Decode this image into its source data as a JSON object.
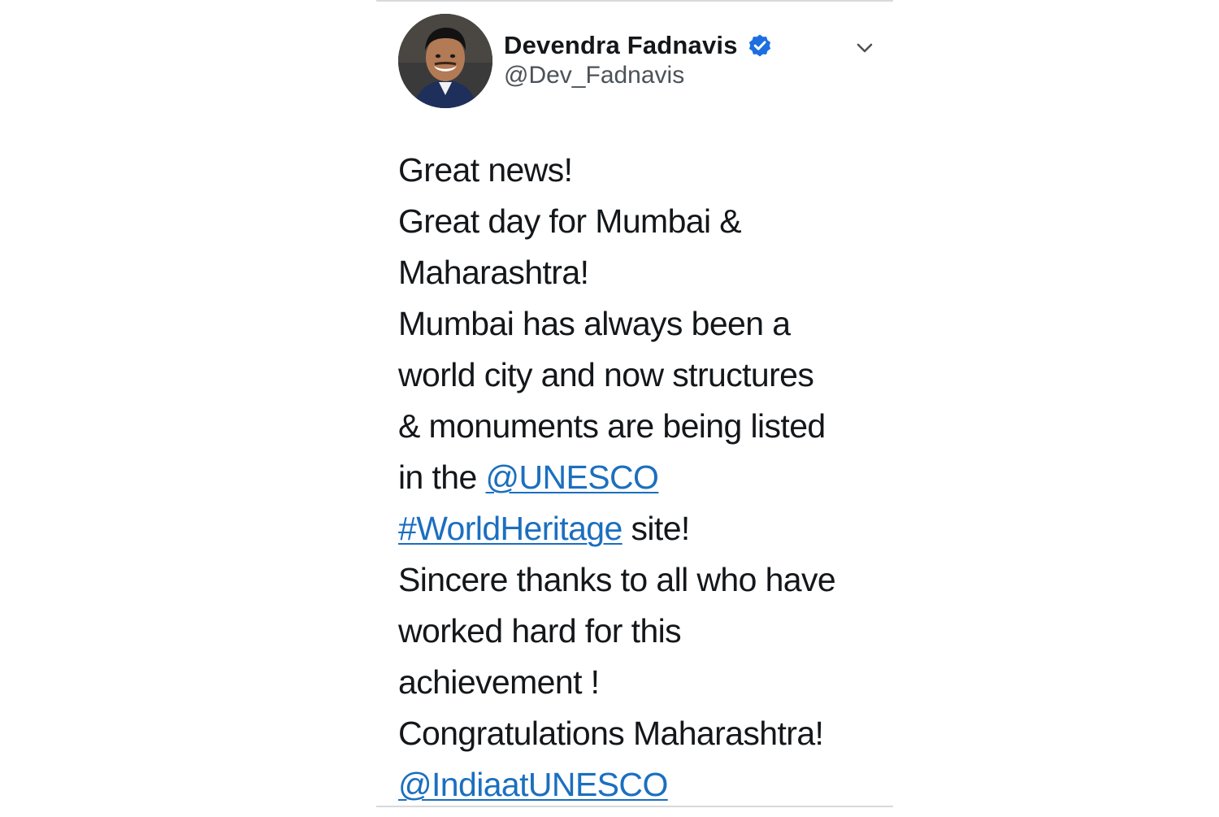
{
  "tweet": {
    "author": {
      "display_name": "Devendra Fadnavis",
      "handle": "@Dev_Fadnavis",
      "verified": true
    },
    "lines": [
      {
        "text": "Great news!"
      },
      {
        "text": "Great day for Mumbai &"
      },
      {
        "text": "Maharashtra!"
      },
      {
        "text": "Mumbai has always been a"
      },
      {
        "text": "world city and now structures"
      },
      {
        "text": "& monuments  are being listed"
      },
      {
        "text": "in the ",
        "link": "@UNESCO"
      },
      {
        "link": "#WorldHeritage",
        "after": " site!"
      },
      {
        "text": "Sincere thanks to all who have"
      },
      {
        "text": "worked hard for this"
      },
      {
        "text": "achievement !"
      },
      {
        "text": "Congratulations Maharashtra!"
      },
      {
        "link": "@IndiaatUNESCO"
      }
    ]
  },
  "icons": {
    "verified": "verified-badge-icon",
    "menu": "chevron-down-icon"
  },
  "colors": {
    "link": "#1b6fbf",
    "verified": "#1d6fe0",
    "text": "#14171a",
    "handle": "#4b5258"
  }
}
